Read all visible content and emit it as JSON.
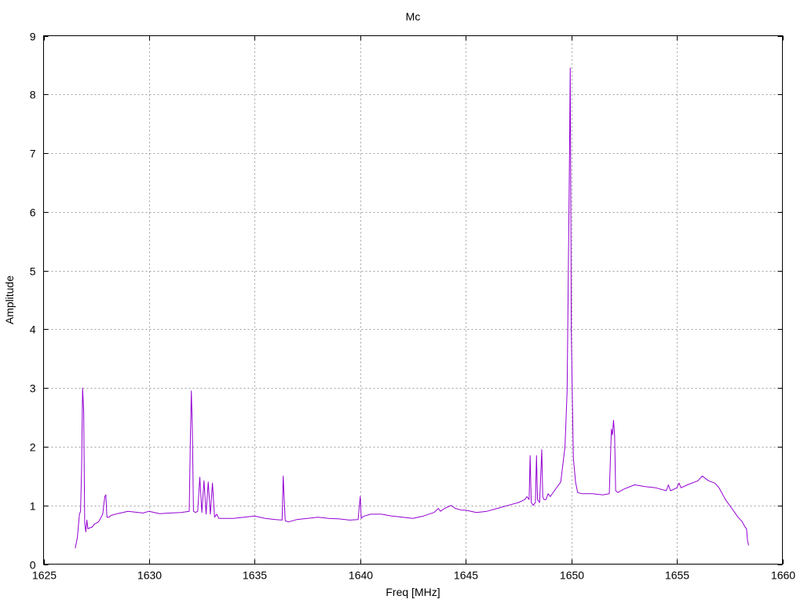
{
  "chart_data": {
    "type": "line",
    "title": "Mc",
    "xlabel": "Freq [MHz]",
    "ylabel": "Amplitude",
    "xlim": [
      1625,
      1660
    ],
    "ylim": [
      0,
      9
    ],
    "grid": true,
    "x_ticks": [
      1625,
      1630,
      1635,
      1640,
      1645,
      1650,
      1655,
      1660
    ],
    "y_ticks": [
      0,
      1,
      2,
      3,
      4,
      5,
      6,
      7,
      8,
      9
    ],
    "series": [
      {
        "color": "#9400d3",
        "x": [
          1626.5,
          1626.6,
          1626.7,
          1626.75,
          1626.8,
          1626.85,
          1626.9,
          1626.95,
          1627.0,
          1627.05,
          1627.1,
          1627.2,
          1627.3,
          1627.4,
          1627.5,
          1627.6,
          1627.7,
          1627.8,
          1627.9,
          1627.95,
          1628.0,
          1628.1,
          1628.2,
          1628.5,
          1629.0,
          1629.5,
          1629.7,
          1630.0,
          1630.5,
          1631.0,
          1631.5,
          1631.9,
          1631.95,
          1632.0,
          1632.05,
          1632.1,
          1632.2,
          1632.3,
          1632.4,
          1632.5,
          1632.6,
          1632.7,
          1632.8,
          1632.9,
          1633.0,
          1633.1,
          1633.2,
          1633.3,
          1633.5,
          1634.0,
          1634.5,
          1635.0,
          1635.5,
          1636.0,
          1636.3,
          1636.35,
          1636.4,
          1636.45,
          1636.5,
          1636.6,
          1637.0,
          1637.5,
          1638.0,
          1638.5,
          1639.0,
          1639.5,
          1639.9,
          1640.0,
          1640.05,
          1640.1,
          1640.2,
          1640.5,
          1641.0,
          1641.5,
          1642.0,
          1642.5,
          1643.0,
          1643.5,
          1643.7,
          1643.8,
          1644.0,
          1644.3,
          1644.5,
          1644.8,
          1645.0,
          1645.5,
          1646.0,
          1646.5,
          1647.0,
          1647.5,
          1647.8,
          1647.9,
          1648.0,
          1648.05,
          1648.1,
          1648.2,
          1648.3,
          1648.35,
          1648.4,
          1648.5,
          1648.6,
          1648.65,
          1648.7,
          1648.8,
          1648.9,
          1649.0,
          1649.2,
          1649.5,
          1649.7,
          1649.8,
          1649.9,
          1649.95,
          1650.0,
          1650.05,
          1650.1,
          1650.15,
          1650.2,
          1650.3,
          1650.5,
          1651.0,
          1651.5,
          1651.8,
          1651.9,
          1651.95,
          1652.0,
          1652.05,
          1652.1,
          1652.2,
          1652.5,
          1653.0,
          1653.5,
          1654.0,
          1654.5,
          1654.6,
          1654.7,
          1655.0,
          1655.1,
          1655.2,
          1655.5,
          1656.0,
          1656.2,
          1656.5,
          1656.8,
          1657.0,
          1657.3,
          1657.6,
          1657.9,
          1658.1,
          1658.2,
          1658.3,
          1658.35,
          1658.4
        ],
        "y": [
          0.27,
          0.45,
          0.85,
          0.9,
          1.6,
          3.0,
          2.6,
          0.7,
          0.55,
          0.75,
          0.6,
          0.62,
          0.63,
          0.68,
          0.7,
          0.72,
          0.78,
          0.85,
          1.15,
          1.18,
          0.8,
          0.8,
          0.83,
          0.86,
          0.9,
          0.88,
          0.87,
          0.9,
          0.86,
          0.87,
          0.88,
          0.9,
          2.1,
          2.95,
          2.3,
          0.9,
          0.88,
          0.9,
          1.48,
          0.88,
          1.42,
          0.85,
          1.4,
          0.85,
          1.38,
          0.8,
          0.85,
          0.78,
          0.78,
          0.78,
          0.8,
          0.82,
          0.78,
          0.76,
          0.75,
          1.5,
          1.1,
          0.74,
          0.73,
          0.72,
          0.76,
          0.78,
          0.8,
          0.78,
          0.77,
          0.75,
          0.76,
          1.15,
          0.78,
          0.8,
          0.82,
          0.85,
          0.85,
          0.82,
          0.8,
          0.78,
          0.82,
          0.88,
          0.95,
          0.9,
          0.95,
          1.0,
          0.95,
          0.92,
          0.92,
          0.88,
          0.9,
          0.95,
          1.0,
          1.05,
          1.1,
          1.15,
          1.1,
          1.85,
          1.05,
          1.0,
          1.05,
          1.85,
          1.1,
          1.05,
          1.95,
          1.15,
          1.1,
          1.1,
          1.2,
          1.15,
          1.25,
          1.4,
          2.0,
          2.95,
          6.5,
          8.45,
          4.0,
          2.8,
          1.8,
          1.6,
          1.4,
          1.22,
          1.2,
          1.2,
          1.18,
          1.2,
          2.3,
          2.2,
          2.45,
          2.2,
          1.25,
          1.22,
          1.28,
          1.35,
          1.32,
          1.3,
          1.25,
          1.35,
          1.25,
          1.3,
          1.38,
          1.3,
          1.35,
          1.42,
          1.5,
          1.42,
          1.38,
          1.3,
          1.1,
          0.95,
          0.8,
          0.72,
          0.65,
          0.6,
          0.4,
          0.32
        ]
      }
    ]
  }
}
